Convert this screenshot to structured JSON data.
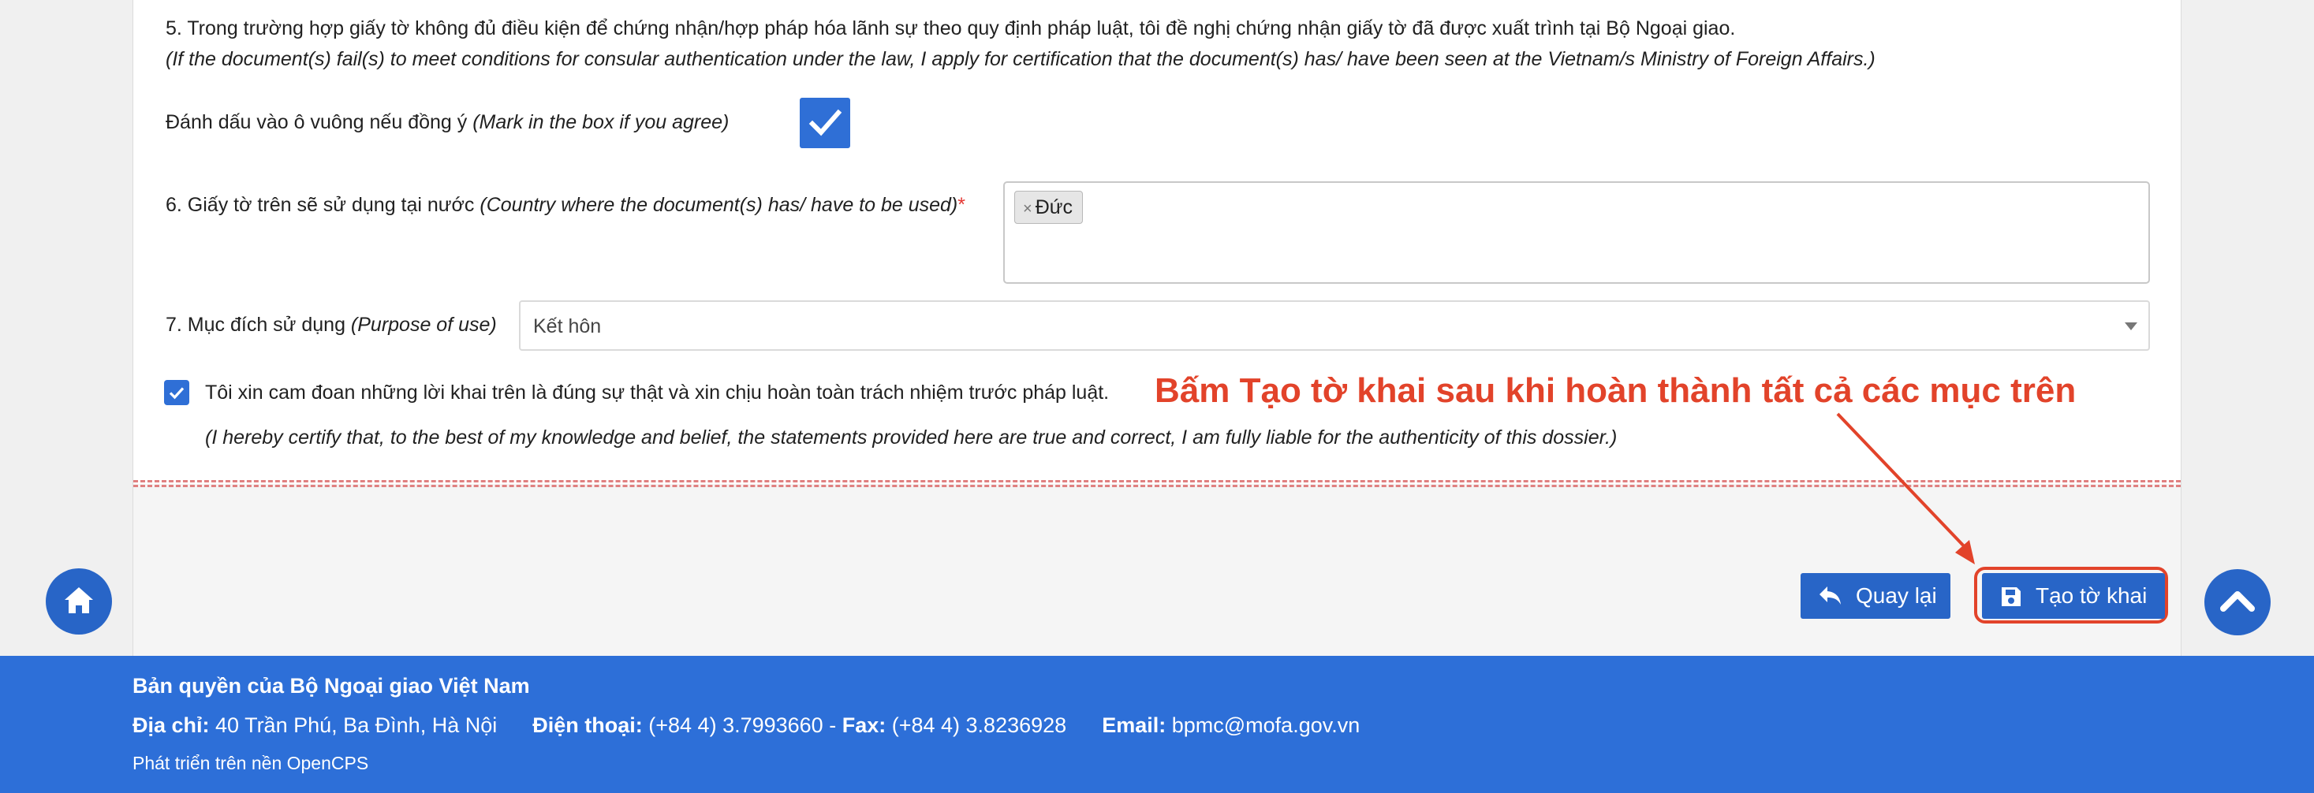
{
  "form": {
    "item5_text": "5. Trong trường hợp giấy tờ không đủ điều kiện để chứng nhận/hợp pháp hóa lãnh sự theo quy định pháp luật, tôi đề nghị chứng nhận giấy tờ đã được xuất trình tại Bộ Ngoại giao.",
    "item5_text_en": "(If the document(s) fail(s) to meet conditions for consular authentication under the law, I apply for certification that the document(s) has/ have been seen at the Vietnam/s Ministry of Foreign Affairs.)",
    "agree_label": "Đánh dấu vào ô vuông nếu đồng ý ",
    "agree_label_en": "(Mark in the box if you agree)",
    "agree_checked": true,
    "item6_label": "6. Giấy tờ trên sẽ sử dụng tại nước ",
    "item6_label_en": "(Country where the document(s) has/ have to be used)",
    "required_mark": "*",
    "country_tags": [
      {
        "remove": "×",
        "label": "Đức"
      }
    ],
    "item7_label": "7. Mục đích sử dụng ",
    "item7_label_en": "(Purpose of use)",
    "purpose_value": "Kết hôn",
    "certify_checked": true,
    "certify_text": "Tôi xin cam đoan những lời khai trên là đúng sự thật và xin chịu hoàn toàn trách nhiệm trước pháp luật.",
    "certify_text_en": "(I hereby certify that, to the best of my knowledge and belief, the statements provided here are true and correct, I am fully liable for the authenticity of this dossier.)"
  },
  "annotation": {
    "text": "Bấm Tạo tờ khai sau khi hoàn thành tất cả các mục trên",
    "color": "#e2432a"
  },
  "actions": {
    "back_label": "Quay lại",
    "back_icon": "reply-arrow-icon",
    "create_label": "Tạo tờ khai",
    "create_icon": "save-floppy-icon"
  },
  "fabs": {
    "home_icon": "home-icon",
    "scroll_top_icon": "chevron-up-icon"
  },
  "footer": {
    "copyright": "Bản quyền của Bộ Ngoại giao Việt Nam",
    "address_label": "Địa chỉ:",
    "address_value": " 40 Trần Phú, Ba Đình, Hà Nội",
    "phone_label": "Điện thoại:",
    "phone_value": " (+84 4) 3.7993660 - ",
    "fax_label": "Fax:",
    "fax_value": " (+84 4) 3.8236928",
    "email_label": "Email:",
    "email_value": " bpmc@mofa.gov.vn",
    "powered_by": "Phát triển trên nền OpenCPS"
  },
  "colors": {
    "primary": "#2865c7",
    "footer_bg": "#2d6fd8",
    "accent_red": "#e2432a"
  }
}
